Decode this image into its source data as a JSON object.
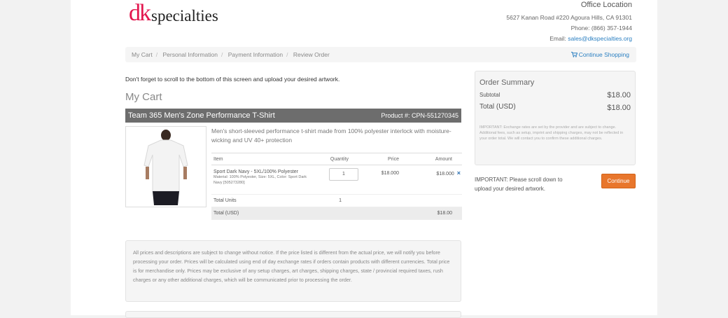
{
  "brand": {
    "logo_mark": "dk",
    "logo_text": "specialties",
    "mark_color": "#e3174f"
  },
  "office": {
    "title": "Office Location",
    "address": "5627 Kanan Road #220 Agoura Hills, CA 91301",
    "phone": "Phone: (866) 357-1944",
    "email_label": "Email:",
    "email": "sales@dkspecialties.org"
  },
  "breadcrumb": {
    "items": [
      "My Cart",
      "Personal Information",
      "Payment Information",
      "Review Order"
    ],
    "continue_label": "Continue Shopping",
    "continue_icon": "cart-icon"
  },
  "scroll_note": "Don't forget to scroll to the bottom of this screen and upload your desired artwork.",
  "cart_title": "My Cart",
  "product": {
    "name": "Team 365 Men's Zone Performance T-Shirt",
    "number": "Product #: CPN-551270345",
    "description": "Men's short-sleeved performance t-shirt made from 100% polyester interlock with moisture-wicking and UV 40+ protection"
  },
  "table": {
    "headers": [
      "Item",
      "Quantity",
      "Price",
      "Amount"
    ],
    "row": {
      "item": "Sport Dark Navy - 5XL/100% Polyester",
      "detail": "Material: 100% Polyester, Size: 5XL, Color: Sport Dark Navy [505273280]",
      "quantity": "1",
      "price": "$18.000",
      "amount": "$18.000",
      "remove": "×"
    },
    "total_units_label": "Total Units",
    "total_units": "1",
    "total_usd_label": "Total (USD)",
    "total_usd": "$18.00"
  },
  "disclaimer": "All prices and descriptions are subject to change without notice. If the price listed is different from the actual price, we will notify you before processing your order. Prices will be calculated using end of day exchange rates if orders contain products with different currencies. Total price is for merchandise only. Prices may be exclusive of any setup charges, art charges, shipping charges, state / provincial required taxes, rush charges or any other additional charges, which will be communicated prior to processing the order.",
  "summary": {
    "title": "Order Summary",
    "subtotal_label": "Subtotal",
    "subtotal": "$18.00",
    "total_label": "Total (USD)",
    "total": "$18.00",
    "note": "IMPORTANT: Exchange rates are set by the provider and are subject to change. Additional fees, such as setup, imprint and shipping charges, may not be reflected in your order total. We will contact you to confirm these additional charges."
  },
  "important": "IMPORTANT: Please scroll down to upload your desired artwork.",
  "continue_button": "Continue",
  "accent_color": "#e8762c",
  "link_color": "#2a7fc1"
}
